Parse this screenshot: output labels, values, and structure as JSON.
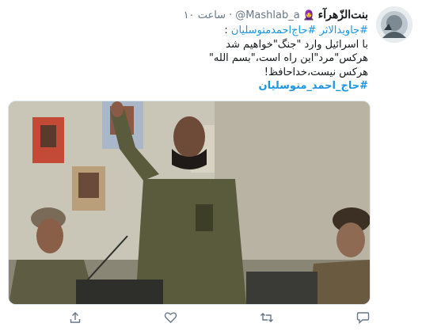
{
  "tweet": {
    "display_name": "بنت‌الزّهرآء",
    "handle": "@Mashlab_a",
    "separator": "·",
    "time": "۱۰ ساعت",
    "lines": [
      {
        "parts": [
          {
            "text": "#جاویدالاثر",
            "kind": "hashtag"
          },
          {
            "text": " ",
            "kind": "text"
          },
          {
            "text": "#حاج‌احمدمتوسلیان",
            "kind": "hashtag"
          },
          {
            "text": " :",
            "kind": "text"
          }
        ]
      },
      {
        "parts": [
          {
            "text": "با اسرائیل وارد \"جنگ\"خواهیم شد",
            "kind": "text"
          }
        ]
      },
      {
        "parts": [
          {
            "text": "هرکس\"مرد\"این راه است،\"بسم الله\"",
            "kind": "text"
          }
        ]
      },
      {
        "parts": [
          {
            "text": "هرکس نیست،خداحافظ!",
            "kind": "text"
          }
        ]
      },
      {
        "parts": [
          {
            "text": "#حاج_احمد_متوسلیان",
            "kind": "hashtag-bold"
          }
        ]
      }
    ]
  },
  "actions": {
    "icons": [
      "share-icon",
      "like-icon",
      "retweet-icon",
      "reply-icon"
    ]
  },
  "colors": {
    "link": "#1b95e0",
    "muted": "#657786"
  }
}
